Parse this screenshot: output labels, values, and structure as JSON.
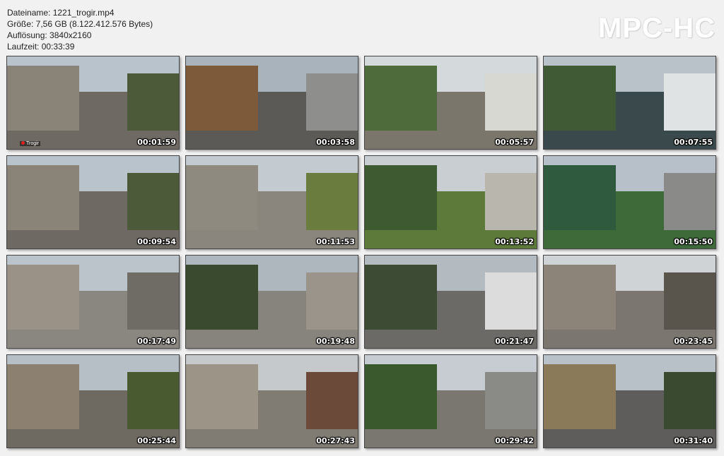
{
  "header": {
    "filename": "Dateiname: 1221_trogir.mp4",
    "size": "Größe: 7,56 GB (8.122.412.576 Bytes)",
    "resolution": "Auflösung: 3840x2160",
    "duration": "Laufzeit: 00:33:39"
  },
  "logo": "MPC-HC",
  "thumbnails": [
    {
      "time": "00:01:59",
      "sky": "#b9c3cc",
      "ground": "#6e6a63",
      "a": "#8a8378",
      "b": "#4d5a3a"
    },
    {
      "time": "00:03:58",
      "sky": "#a9b3bb",
      "ground": "#5c5a56",
      "a": "#7d5a3a",
      "b": "#8e8f8c"
    },
    {
      "time": "00:05:57",
      "sky": "#d4d9dc",
      "ground": "#7a766c",
      "a": "#4e6b3c",
      "b": "#d8d8d3"
    },
    {
      "time": "00:07:55",
      "sky": "#b9c2c9",
      "ground": "#3a4a4c",
      "a": "#3f5a34",
      "b": "#e0e3e4"
    },
    {
      "time": "00:09:54",
      "sky": "#b9c3cc",
      "ground": "#6e6a63",
      "a": "#8a8378",
      "b": "#4d5a3a"
    },
    {
      "time": "00:11:53",
      "sky": "#c3cbd1",
      "ground": "#8a867d",
      "a": "#8f8a80",
      "b": "#6a7c3e"
    },
    {
      "time": "00:13:52",
      "sky": "#c8ced2",
      "ground": "#5e7a3a",
      "a": "#3e5a30",
      "b": "#b9b6ae"
    },
    {
      "time": "00:15:50",
      "sky": "#b7c0c8",
      "ground": "#3e6a3a",
      "a": "#2f5a3e",
      "b": "#8a8a88"
    },
    {
      "time": "00:17:49",
      "sky": "#bcc4cb",
      "ground": "#8a8680",
      "a": "#9a9286",
      "b": "#6f6c66"
    },
    {
      "time": "00:19:48",
      "sky": "#aeb6be",
      "ground": "#87847e",
      "a": "#3a4a2e",
      "b": "#9a948a"
    },
    {
      "time": "00:21:47",
      "sky": "#b3bac0",
      "ground": "#6c6a66",
      "a": "#3d4a34",
      "b": "#dcdcdc"
    },
    {
      "time": "00:23:45",
      "sky": "#d0d3d5",
      "ground": "#7b7770",
      "a": "#8c8478",
      "b": "#5a554c"
    },
    {
      "time": "00:25:44",
      "sky": "#b6bec6",
      "ground": "#6e6a62",
      "a": "#8c8070",
      "b": "#4a5a30"
    },
    {
      "time": "00:27:43",
      "sky": "#c5c9cc",
      "ground": "#807c74",
      "a": "#9c9486",
      "b": "#6c4a3a"
    },
    {
      "time": "00:29:42",
      "sky": "#c6ccd1",
      "ground": "#7a7670",
      "a": "#3a5a2e",
      "b": "#8a8a86"
    },
    {
      "time": "00:31:40",
      "sky": "#b9c1c8",
      "ground": "#5e5d5b",
      "a": "#8a7a5a",
      "b": "#3a4a30"
    }
  ],
  "rec_label": "Trogir"
}
